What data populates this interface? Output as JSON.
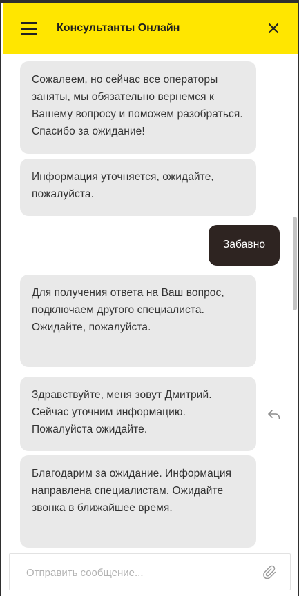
{
  "header": {
    "title": "Консультанты Онлайн",
    "menu_icon": "hamburger-menu-icon",
    "close_icon": "close-icon"
  },
  "messages": [
    {
      "from": "operator",
      "text": "Сожалеем, но сейчас все операторы заняты, мы обязательно вернемся к Вашему вопросу и поможем разобраться. Спасибо за ожидание!"
    },
    {
      "from": "operator",
      "text": "Информация уточняется, ожидайте, пожалуйста."
    },
    {
      "from": "user",
      "text": "Забавно"
    },
    {
      "from": "operator",
      "text": "Для получения ответа на Ваш вопрос, подключаем другого специалиста. Ожидайте, пожалуйста."
    },
    {
      "from": "operator",
      "text": "Здравствуйте, меня зовут Дмитрий. Сейчас уточним информацию. Пожалуйста ожидайте."
    },
    {
      "from": "operator",
      "text": "Благодарим за ожидание. Информация направлена специалистам. Ожидайте звонка в ближайшее время."
    }
  ],
  "composer": {
    "placeholder": "Отправить сообщение...",
    "value": "",
    "attach_icon": "paperclip-icon",
    "reply_icon": "reply-icon"
  },
  "colors": {
    "header_bg": "#ffe600",
    "operator_bubble": "#e9e9e9",
    "user_bubble": "#2e2421",
    "text": "#333333"
  }
}
